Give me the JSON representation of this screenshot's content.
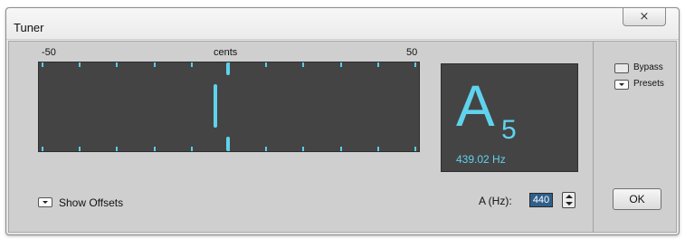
{
  "window": {
    "title": "Tuner",
    "close_label": "⨯"
  },
  "meter": {
    "scale_left": "-50",
    "scale_center": "cents",
    "scale_right": "50",
    "needle_cents": 0,
    "accent_color": "#5fd3ee"
  },
  "display": {
    "note": "A",
    "octave": "5",
    "frequency": "439.02 Hz"
  },
  "controls": {
    "show_offsets_label": "Show Offsets",
    "a_hz_label": "A (Hz):",
    "a_hz_value": "440",
    "bypass_label": "Bypass",
    "presets_label": "Presets",
    "ok_label": "OK"
  }
}
